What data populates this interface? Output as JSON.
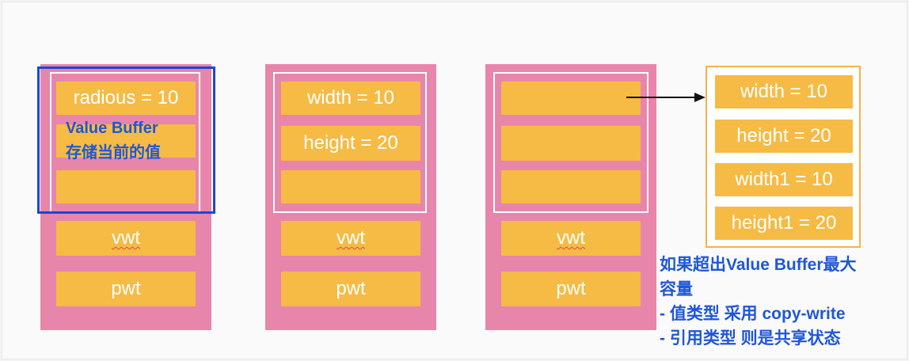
{
  "containers": [
    {
      "value_buffer": [
        "radious = 10",
        "",
        ""
      ],
      "annotation": [
        "Value Buffer",
        "存储当前的值"
      ],
      "vwt": "vwt",
      "pwt": "pwt"
    },
    {
      "value_buffer": [
        "width = 10",
        "height = 20",
        ""
      ],
      "vwt": "vwt",
      "pwt": "pwt"
    },
    {
      "value_buffer": [
        "",
        "",
        ""
      ],
      "vwt": "vwt",
      "pwt": "pwt"
    }
  ],
  "heap_box": [
    "width = 10",
    "height = 20",
    "width1 = 10",
    "height1 = 20"
  ],
  "note": [
    "如果超出Value Buffer最大",
    "容量",
    "- 值类型 采用 copy-write",
    "- 引用类型 则是共享状态"
  ],
  "colors": {
    "container": "#e885ab",
    "cell": "#f5bb45",
    "highlight": "#1a47d6",
    "note_text": "#1f57d6",
    "heap_border": "#f5b24c"
  }
}
